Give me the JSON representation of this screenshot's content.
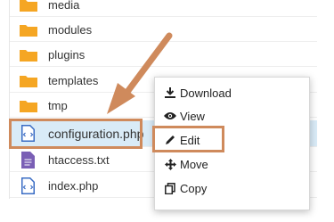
{
  "files": [
    {
      "name": "media",
      "type": "folder"
    },
    {
      "name": "modules",
      "type": "folder"
    },
    {
      "name": "plugins",
      "type": "folder"
    },
    {
      "name": "templates",
      "type": "folder"
    },
    {
      "name": "tmp",
      "type": "folder"
    },
    {
      "name": "configuration.php",
      "type": "php",
      "selected": true
    },
    {
      "name": "htaccess.txt",
      "type": "txt"
    },
    {
      "name": "index.php",
      "type": "php"
    }
  ],
  "context_menu": {
    "items": [
      {
        "label": "Download",
        "icon": "download-icon"
      },
      {
        "label": "View",
        "icon": "eye-icon"
      },
      {
        "label": "Edit",
        "icon": "pencil-icon",
        "highlighted": true
      },
      {
        "label": "Move",
        "icon": "move-icon"
      },
      {
        "label": "Copy",
        "icon": "copy-icon"
      }
    ]
  },
  "colors": {
    "folder": "#f5a623",
    "php_icon": "#3a6cc4",
    "txt_icon": "#7a5fb5",
    "highlight": "#cf8a5c",
    "selected_row": "#d9ebf7"
  }
}
